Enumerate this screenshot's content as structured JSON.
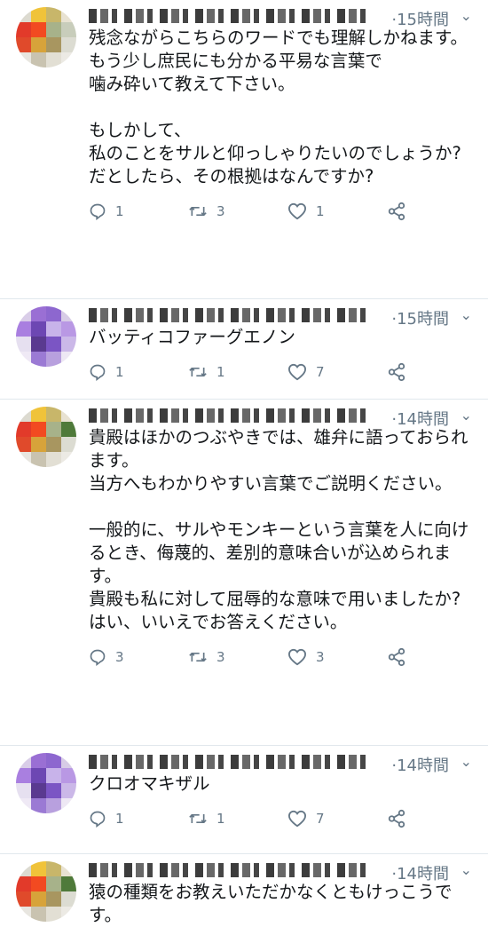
{
  "tweets": [
    {
      "time": "·15時間",
      "text": "残念ながらこちらのワードでも理解しかねます。\nもう少し庶民にも分かる平易な言葉で\n噛み砕いて教えて下さい。\n\nもしかして、\n私のことをサルと仰っしゃりたいのでしょうか?\nだとしたら、その根拠はなんですか?",
      "replies": "1",
      "retweets": "3",
      "likes": "1",
      "avatar_colors": [
        "#dcdad0",
        "#f0c33a",
        "#c8b66a",
        "#e8e2d2",
        "#e23a2a",
        "#f24a21",
        "#a7b28a",
        "#c8cdbb",
        "#e04a2b",
        "#d7a33a",
        "#a89660",
        "#dcdcd2",
        "#e8e6e0",
        "#c9c3b0",
        "#e2dfd4",
        "#eceae4"
      ]
    },
    {
      "time": "·15時間",
      "text": "バッティコファーグエノン",
      "replies": "1",
      "retweets": "1",
      "likes": "7",
      "avatar_colors": [
        "#d9cde8",
        "#9a6fd4",
        "#8d67cf",
        "#d7cce6",
        "#a97fe0",
        "#6d47b3",
        "#c8b3ea",
        "#b998e4",
        "#e6e0f0",
        "#5a3a90",
        "#7b55c4",
        "#cbb8e8",
        "#efe9f5",
        "#9b7ad4",
        "#b8a0de",
        "#eee8f4"
      ]
    },
    {
      "time": "·14時間",
      "text": "貴殿はほかのつぶやきでは、雄弁に語っておられます。\n当方へもわかりやすい言葉でご説明ください。\n\n一般的に、サルやモンキーという言葉を人に向けるとき、侮蔑的、差別的意味合いが込められます。\n貴殿も私に対して屈辱的な意味で用いましたか?\nはい、いいえでお答えください。",
      "replies": "3",
      "retweets": "3",
      "likes": "3",
      "avatar_colors": [
        "#dcdad0",
        "#f0c33a",
        "#c8b66a",
        "#e8e2d2",
        "#e23a2a",
        "#f24a21",
        "#a7b28a",
        "#4f7a3a",
        "#e04a2b",
        "#d7a33a",
        "#a89660",
        "#dcdcd2",
        "#e8e6e0",
        "#c9c3b0",
        "#e2dfd4",
        "#eceae4"
      ]
    },
    {
      "time": "·14時間",
      "text": "クロオマキザル",
      "replies": "1",
      "retweets": "1",
      "likes": "7",
      "avatar_colors": [
        "#d9cde8",
        "#9a6fd4",
        "#8d67cf",
        "#d7cce6",
        "#a97fe0",
        "#6d47b3",
        "#c8b3ea",
        "#b998e4",
        "#e6e0f0",
        "#5a3a90",
        "#7b55c4",
        "#cbb8e8",
        "#efe9f5",
        "#9b7ad4",
        "#b8a0de",
        "#eee8f4"
      ]
    },
    {
      "time": "·14時間",
      "text": "猿の種類をお教えいただかなくともけっこうです。",
      "replies": "",
      "retweets": "",
      "likes": "",
      "avatar_colors": [
        "#dcdad0",
        "#f0c33a",
        "#c8b66a",
        "#e8e2d2",
        "#e23a2a",
        "#f24a21",
        "#a7b28a",
        "#4f7a3a",
        "#e04a2b",
        "#d7a33a",
        "#a89660",
        "#dcdcd2",
        "#e8e6e0",
        "#c9c3b0",
        "#e2dfd4",
        "#eceae4"
      ]
    }
  ],
  "icons": {
    "reply": "reply-icon",
    "retweet": "retweet-icon",
    "like": "heart-icon",
    "share": "share-icon",
    "caret": "chevron-down-icon"
  },
  "colors": {
    "meta_gray": "#657786",
    "text": "#14171a",
    "divider": "#e1e8ed"
  }
}
